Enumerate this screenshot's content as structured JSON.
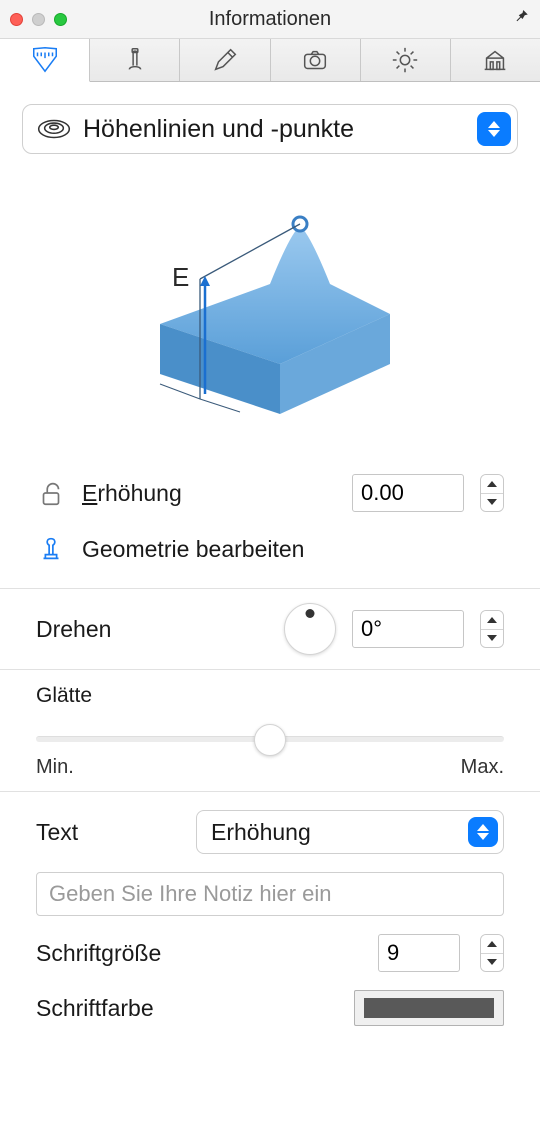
{
  "window": {
    "title": "Informationen"
  },
  "dropdown": {
    "selected": "Höhenlinien und -punkte"
  },
  "illustration": {
    "label": "E"
  },
  "elevation": {
    "label_html": "Erhöhung",
    "value": "0.00"
  },
  "edit_geometry": {
    "label": "Geometrie bearbeiten"
  },
  "rotate": {
    "label": "Drehen",
    "value": "0°"
  },
  "smooth": {
    "label": "Glätte",
    "min": "Min.",
    "max": "Max."
  },
  "text": {
    "label": "Text",
    "dropdown": "Erhöhung",
    "note_placeholder": "Geben Sie Ihre Notiz hier ein",
    "fontsize_label": "Schriftgröße",
    "fontsize_value": "9",
    "fontcolor_label": "Schriftfarbe",
    "fontcolor": "#595959"
  }
}
